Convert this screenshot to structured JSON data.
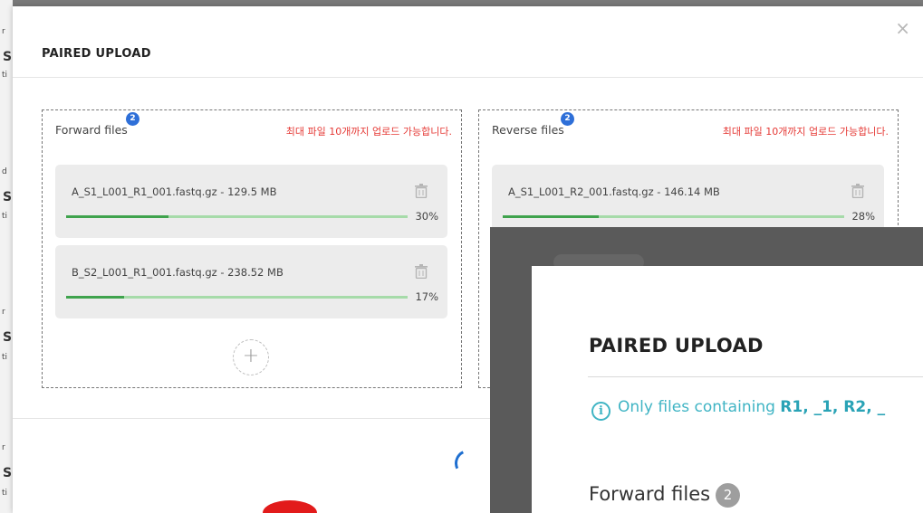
{
  "background": {
    "fragments": [
      "r",
      "S",
      "ti",
      "d",
      "S",
      "ti",
      "r",
      "S",
      "ti",
      "r",
      "S",
      "ti"
    ]
  },
  "modal": {
    "title": "PAIRED UPLOAD",
    "close_icon": "×",
    "limit_notice": "최대 파일 10개까지 업로드 가능합니다.",
    "forward": {
      "label": "Forward files",
      "count": "2",
      "files": [
        {
          "name": "A_S1_L001_R1_001.fastq.gz - 129.5 MB",
          "progress": 30,
          "progress_label": "30%"
        },
        {
          "name": "B_S2_L001_R1_001.fastq.gz - 238.52 MB",
          "progress": 17,
          "progress_label": "17%"
        }
      ],
      "add_label": "+"
    },
    "reverse": {
      "label": "Reverse files",
      "count": "2",
      "files": [
        {
          "name": "A_S1_L001_R2_001.fastq.gz - 146.14 MB",
          "progress": 28,
          "progress_label": "28%"
        }
      ]
    }
  },
  "zoom_overlay": {
    "title": "PAIRED UPLOAD",
    "info_icon": "i",
    "info_prefix": "Only files containing ",
    "info_keywords": "R1, _1, R2, _",
    "forward_label": "Forward files",
    "forward_count": "2"
  },
  "colors": {
    "accent_blue": "#2e6fd8",
    "progress_fill": "#3fa34d",
    "progress_track": "#a6dba9",
    "warning_red": "#e53935",
    "info_teal": "#3fb4c4"
  }
}
